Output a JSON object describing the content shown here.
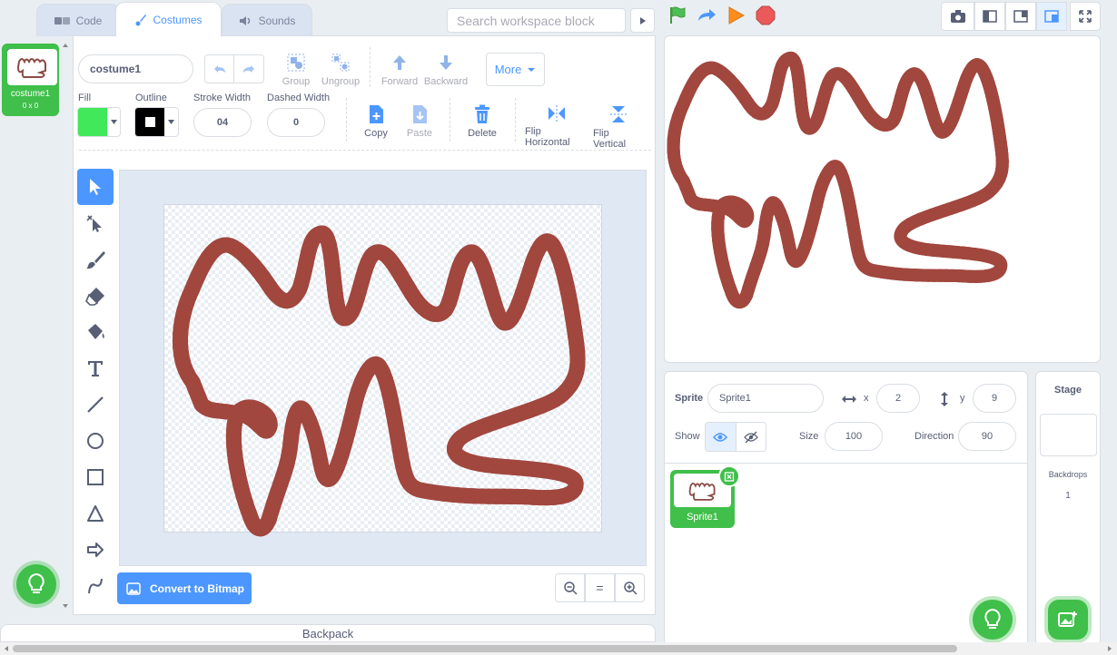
{
  "tabs": [
    {
      "label": "Code",
      "icon": "code-icon"
    },
    {
      "label": "Costumes",
      "icon": "brush-icon"
    },
    {
      "label": "Sounds",
      "icon": "speaker-icon"
    }
  ],
  "search": {
    "placeholder": "Search workspace block"
  },
  "costume_list": [
    {
      "index": "1",
      "name": "costume1",
      "size": "0 x 0"
    }
  ],
  "editor": {
    "costume_name": "costume1",
    "toolbar": {
      "group": "Group",
      "ungroup": "Ungroup",
      "forward": "Forward",
      "backward": "Backward",
      "more": "More"
    },
    "fill_label": "Fill",
    "outline_label": "Outline",
    "stroke_width_label": "Stroke Width",
    "stroke_width_value": "04",
    "dashed_width_label": "Dashed Width",
    "dashed_width_value": "0",
    "copy": "Copy",
    "paste": "Paste",
    "delete": "Delete",
    "flip_h": "Flip Horizontal",
    "flip_v": "Flip Vertical",
    "convert_button": "Convert to Bitmap",
    "zoom_reset": "=",
    "fill_color": "#40e85a",
    "outline_color": "#000000"
  },
  "backpack": {
    "label": "Backpack"
  },
  "sprite_info": {
    "sprite_label": "Sprite",
    "sprite_name": "Sprite1",
    "x_label": "x",
    "x_value": "2",
    "y_label": "y",
    "y_value": "9",
    "show_label": "Show",
    "size_label": "Size",
    "size_value": "100",
    "direction_label": "Direction",
    "direction_value": "90"
  },
  "sprites": [
    {
      "name": "Sprite1"
    }
  ],
  "stage_panel": {
    "title": "Stage",
    "backdrops_label": "Backdrops",
    "backdrops_count": "1"
  },
  "colors": {
    "accent": "#4c97ff",
    "green": "#40bf4a",
    "orange": "#ff8c1a",
    "stop": "#ec5959"
  }
}
